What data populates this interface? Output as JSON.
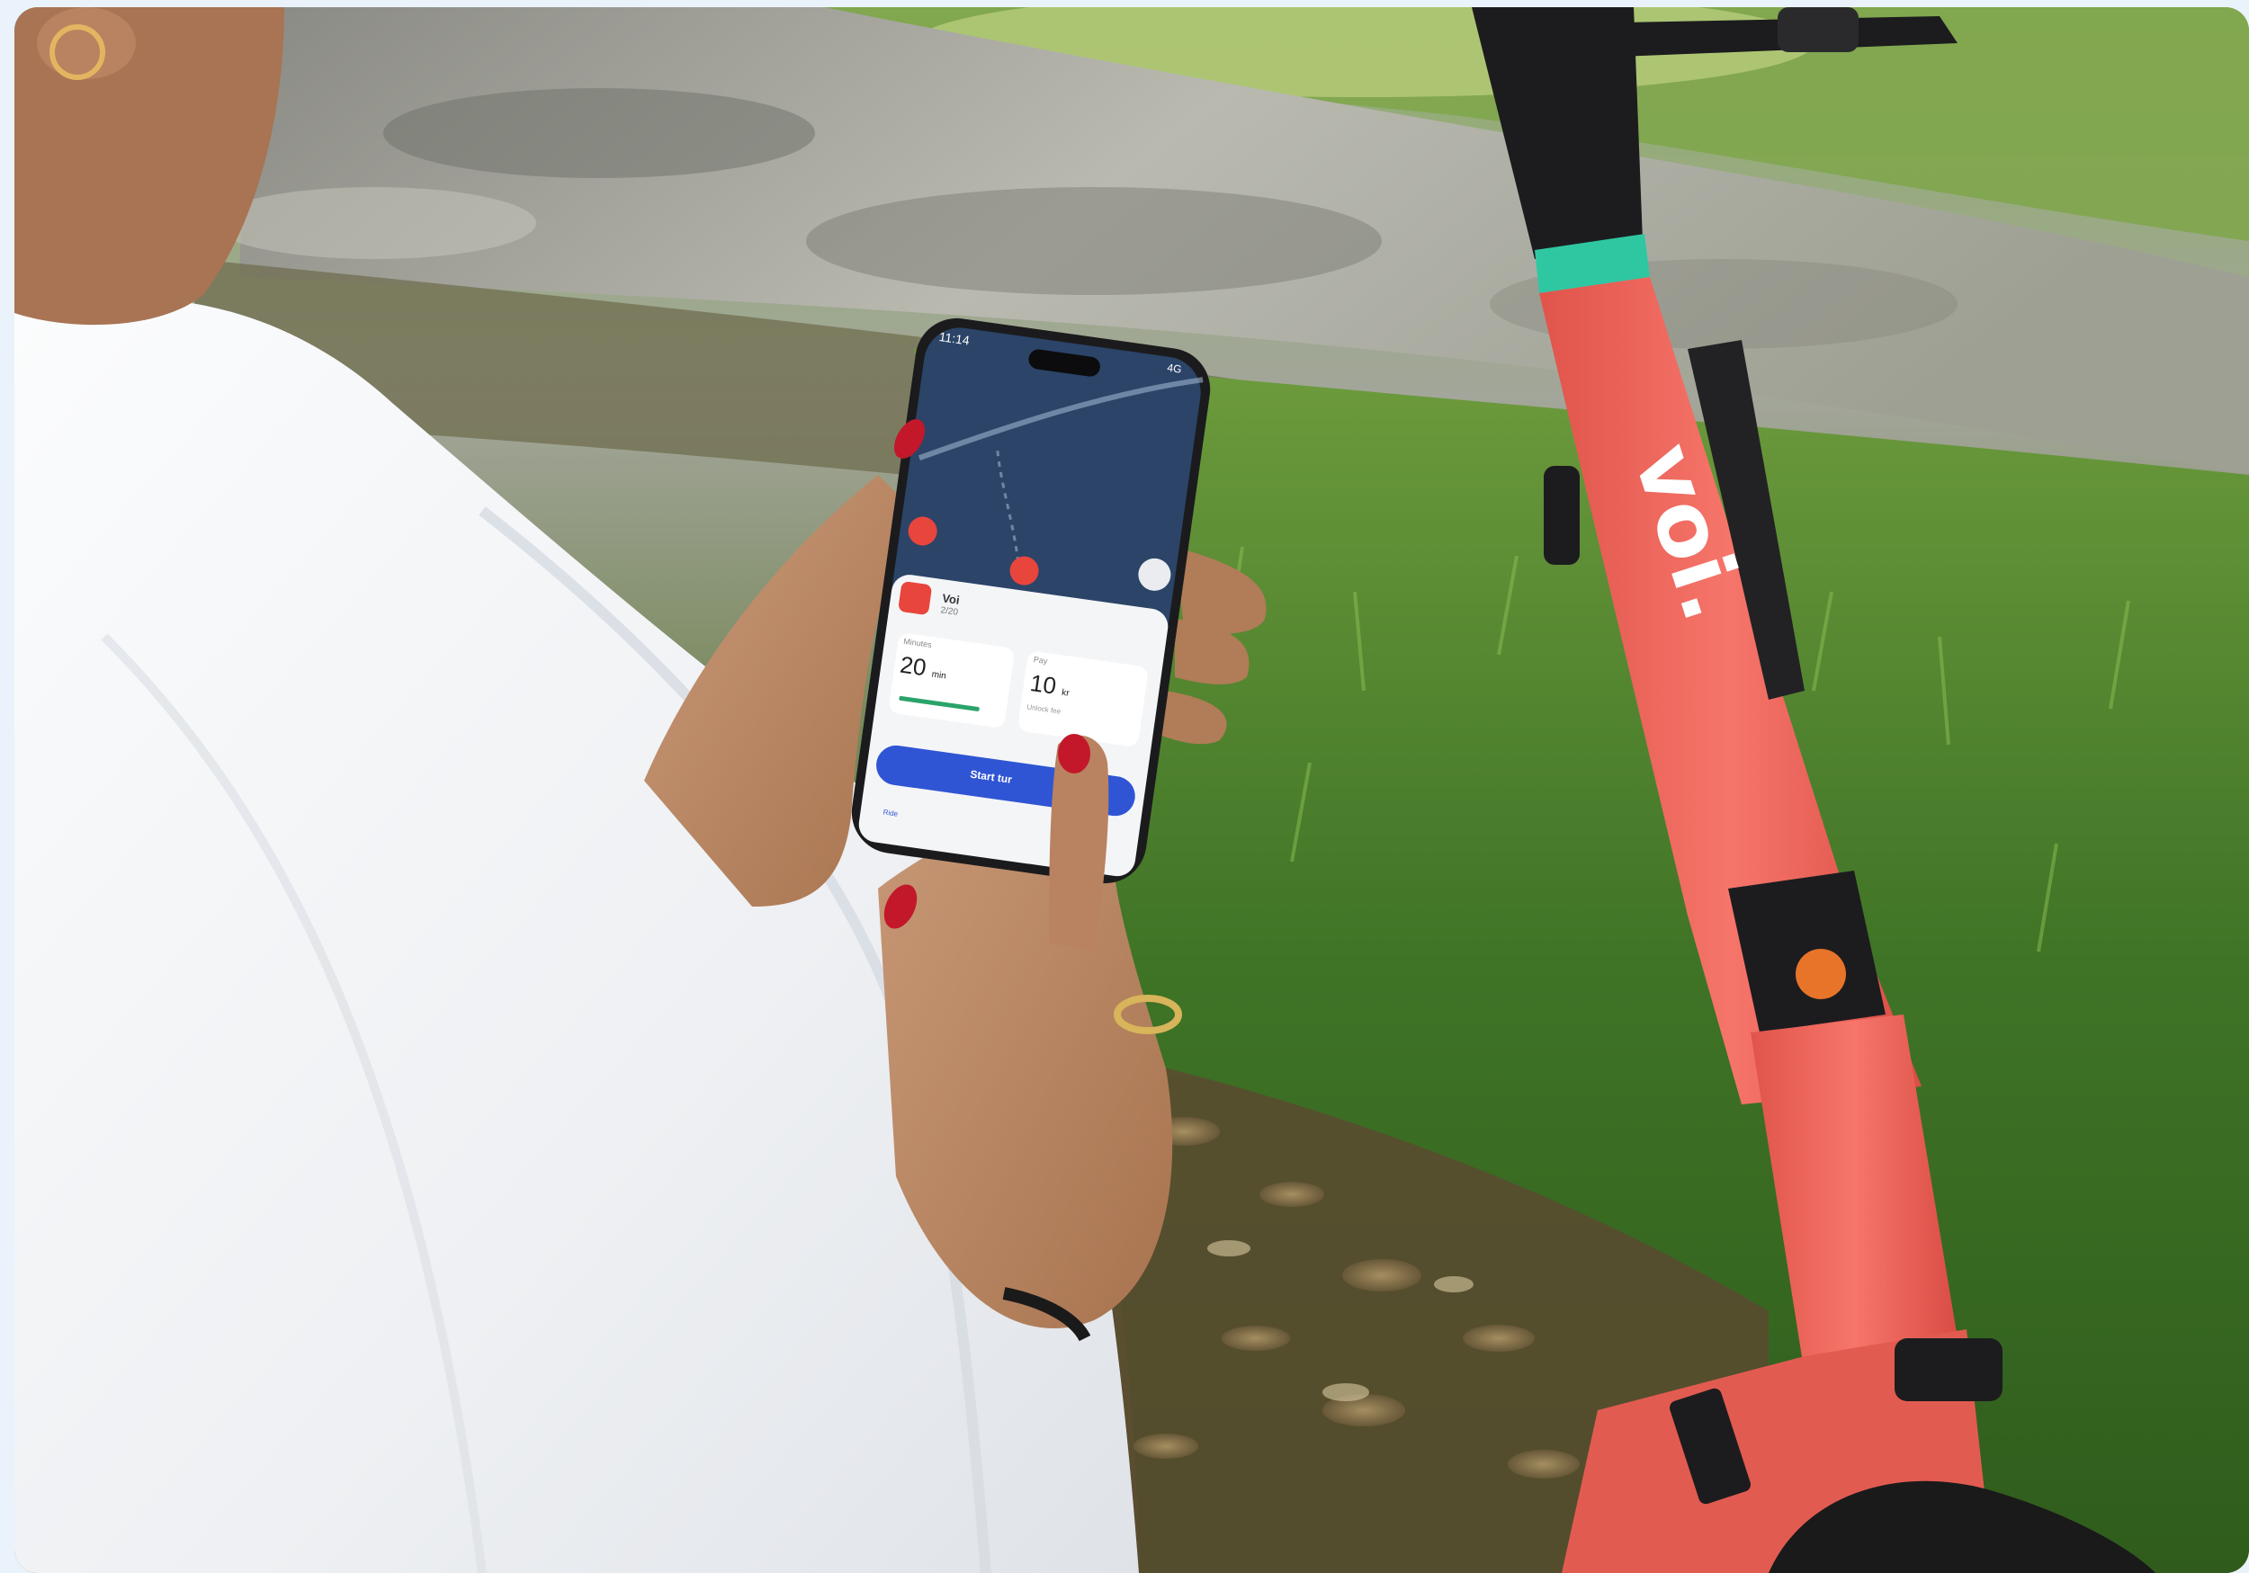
{
  "photo": {
    "brand_text": "voi.",
    "colors": {
      "page_bg": "#eaf3fb",
      "scooter_coral": "#f0655c",
      "scooter_black": "#1c1c1e",
      "teal_ring": "#2fc7a2",
      "shirt_white": "#f2f3f5",
      "phone_screen_map": "#2b4468",
      "app_blue": "#2f55d4",
      "brand_red": "#e8453c"
    }
  },
  "phone": {
    "status_time": "11:14",
    "status_right": "4G",
    "operator_name": "Voi",
    "operator_sub": "2/20",
    "card_left_title": "Minutes",
    "card_left_value": "20",
    "card_left_unit": "min",
    "card_right_title": "Pay",
    "card_right_value": "10",
    "card_right_unit": "kr",
    "card_right_sub": "Unlock fee",
    "start_button": "Start tur",
    "nav_left": "Ride"
  }
}
